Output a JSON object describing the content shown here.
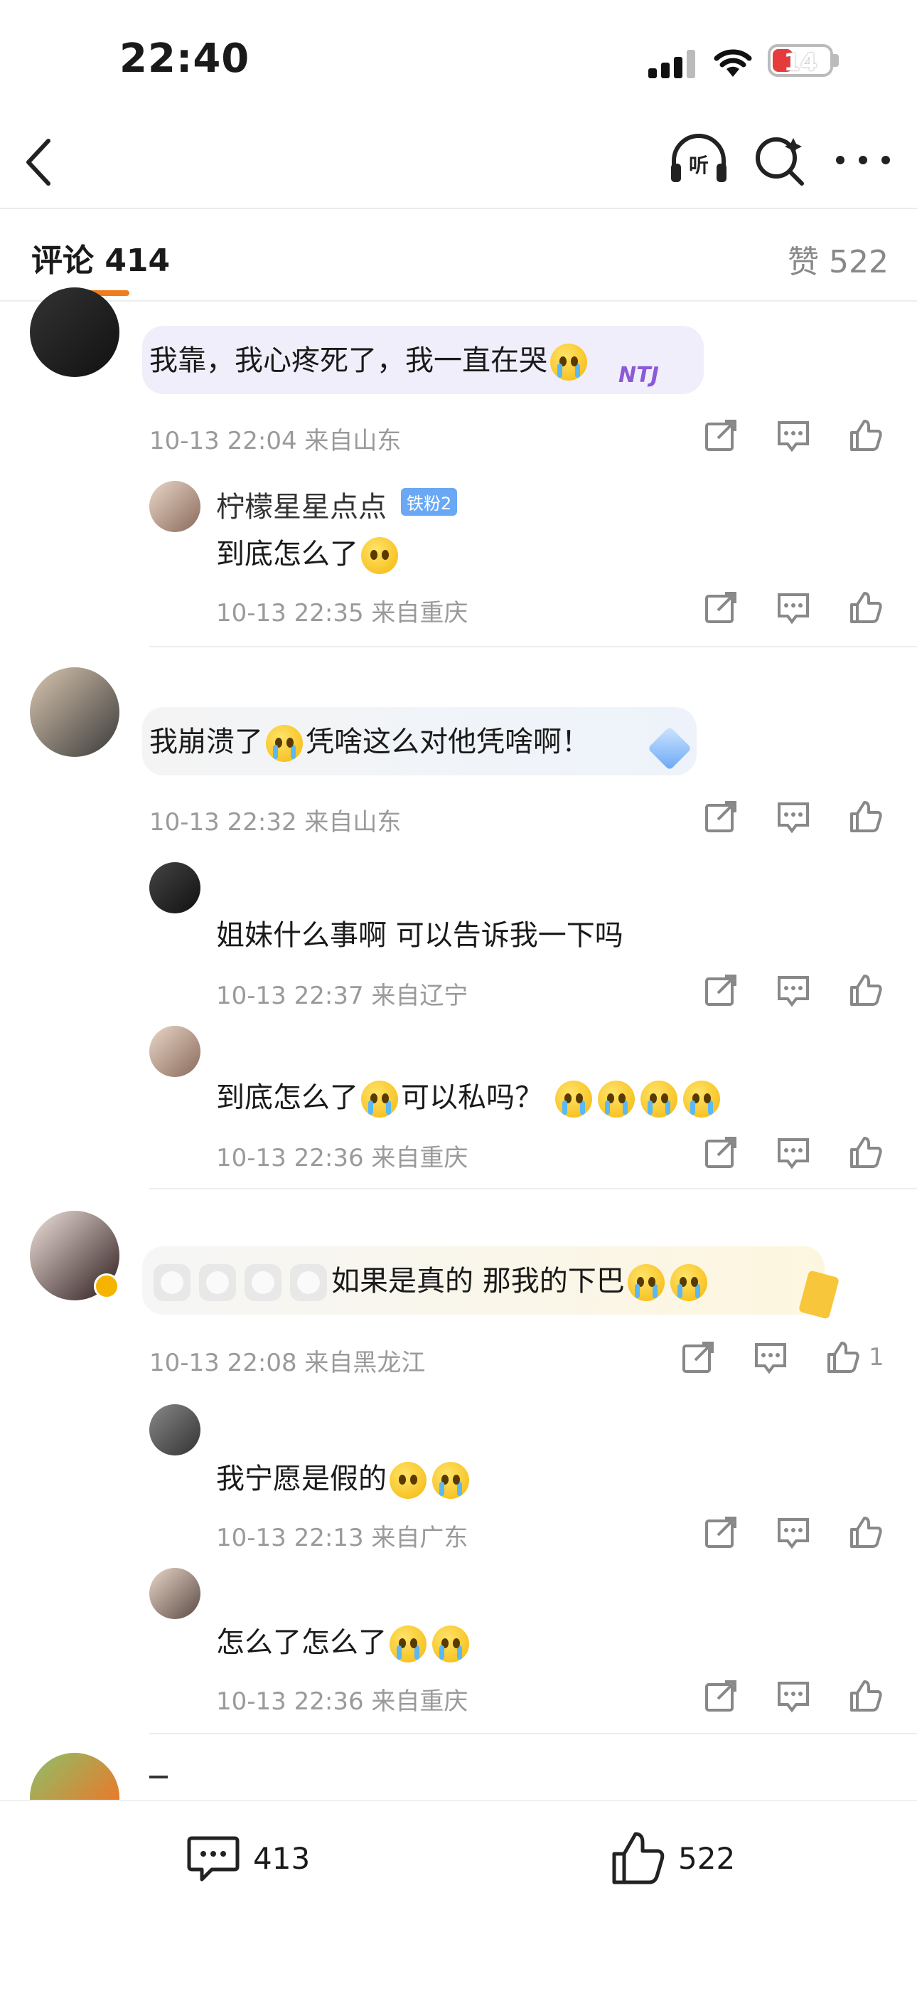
{
  "status": {
    "time": "22:40",
    "battery": "14"
  },
  "tabs": {
    "comments_label": "评论 414",
    "likes_label": "赞 522"
  },
  "comments": [
    {
      "text": "我靠，我心疼死了，我一直在哭",
      "meta": "10-13 22:04 来自山东",
      "replies": [
        {
          "username": "柠檬星星点点",
          "badge": "铁粉2",
          "text": "到底怎么了",
          "meta": "10-13 22:35 来自重庆"
        }
      ]
    },
    {
      "text": "我崩溃了",
      "text2": "凭啥这么对他凭啥啊！",
      "meta": "10-13 22:32 来自山东",
      "replies": [
        {
          "text": "姐妹什么事啊 可以告诉我一下吗",
          "meta": "10-13 22:37 来自辽宁"
        },
        {
          "text": "到底怎么了",
          "text2": "可以私吗？",
          "meta": "10-13 22:36 来自重庆"
        }
      ]
    },
    {
      "text": "如果是真的 那我的下巴",
      "meta": "10-13 22:08 来自黑龙江",
      "like_count": "1",
      "replies": [
        {
          "text": "我宁愿是假的",
          "meta": "10-13 22:13 来自广东"
        },
        {
          "text": "怎么了怎么了",
          "meta": "10-13 22:36 来自重庆"
        }
      ]
    },
    {
      "text": "",
      "meta": ""
    }
  ],
  "bottom": {
    "comment_count": "413",
    "like_count": "522"
  },
  "colors": {
    "accent": "#f07c1e",
    "meta_text": "#9a9a9a"
  }
}
